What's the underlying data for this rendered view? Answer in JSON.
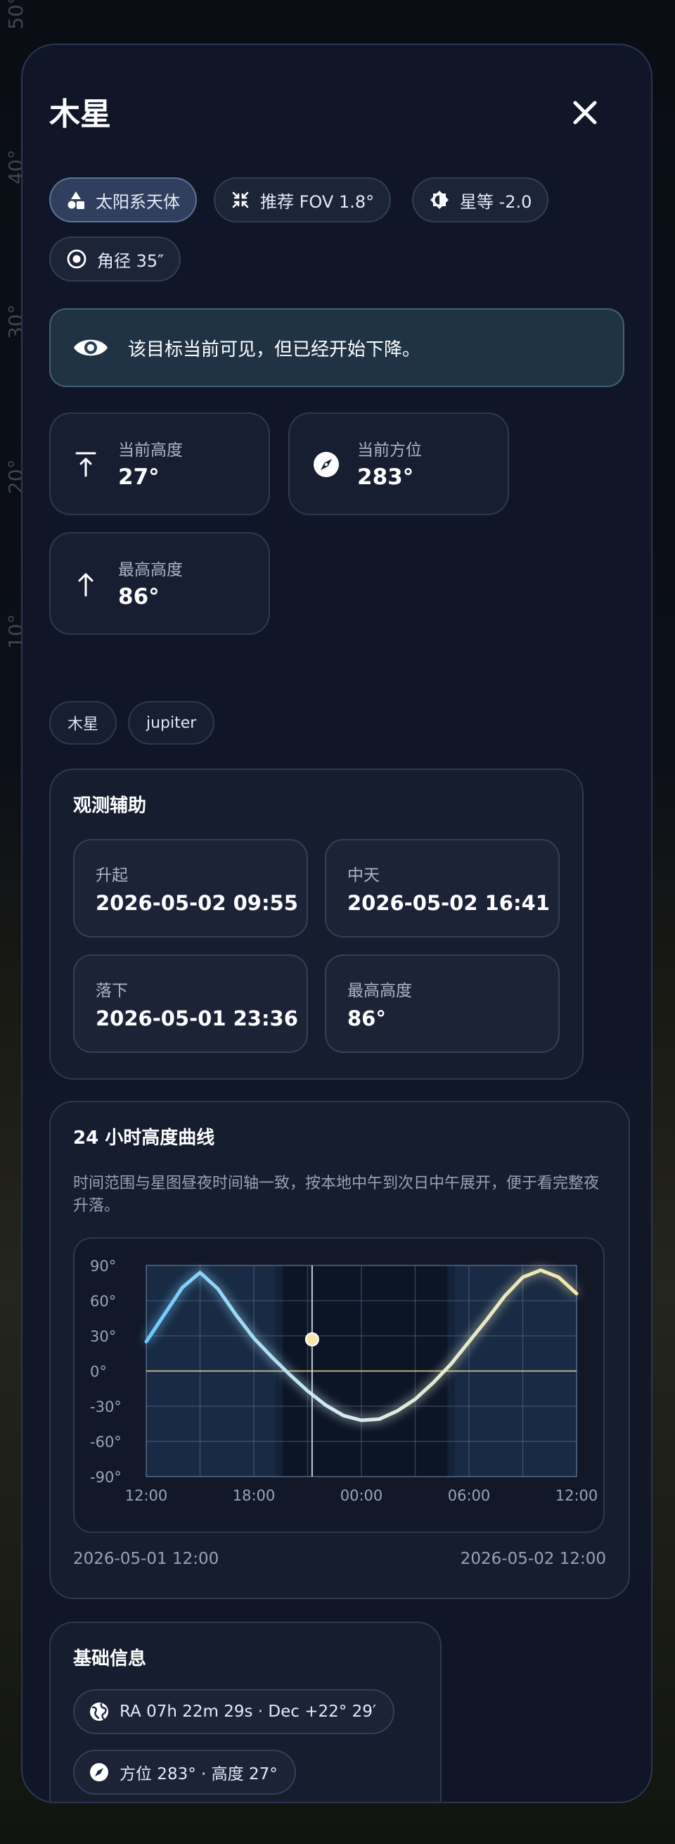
{
  "header": {
    "title": "木星"
  },
  "chips": [
    {
      "icon": "shapes-icon",
      "label": "太阳系天体"
    },
    {
      "icon": "collapse-icon",
      "label": "推荐 FOV 1.8°"
    },
    {
      "icon": "contrast-icon",
      "label": "星等 -2.0"
    },
    {
      "icon": "target-icon",
      "label": "角径 35″"
    }
  ],
  "visibility_banner": {
    "icon": "eye-icon",
    "text": "该目标当前可见，但已经开始下降。"
  },
  "stats": {
    "current_altitude": {
      "label": "当前高度",
      "value": "27°",
      "icon": "altitude-icon"
    },
    "current_azimuth": {
      "label": "当前方位",
      "value": "283°",
      "icon": "compass-icon"
    },
    "max_altitude": {
      "label": "最高高度",
      "value": "86°",
      "icon": "arrow-up-icon"
    }
  },
  "tags": [
    "木星",
    "jupiter"
  ],
  "observation": {
    "title": "观测辅助",
    "rise": {
      "label": "升起",
      "value": "2026-05-02 09:55"
    },
    "transit": {
      "label": "中天",
      "value": "2026-05-02 16:41"
    },
    "set": {
      "label": "落下",
      "value": "2026-05-01 23:36"
    },
    "max_altitude": {
      "label": "最高高度",
      "value": "86°"
    }
  },
  "altitude_curve": {
    "title": "24 小时高度曲线",
    "description": "时间范围与星图昼夜时间轴一致，按本地中午到次日中午展开，便于看完整夜升落。",
    "range_start": "2026-05-01 12:00",
    "range_end": "2026-05-02 12:00"
  },
  "chart_data": {
    "type": "line",
    "x": [
      0,
      1,
      2,
      3,
      4,
      5,
      6,
      7,
      8,
      9,
      10,
      11,
      12,
      13,
      14,
      15,
      16,
      17,
      18,
      19,
      20,
      21,
      22,
      23,
      24
    ],
    "series": [
      {
        "values": [
          25,
          48,
          71,
          84,
          70,
          48,
          28,
          12,
          -3,
          -17,
          -29,
          -38,
          -42,
          -41,
          -34,
          -24,
          -10,
          6,
          25,
          44,
          64,
          80,
          86,
          80,
          66
        ]
      }
    ],
    "xtick_labels": [
      "12:00",
      "18:00",
      "00:00",
      "06:00",
      "12:00"
    ],
    "ytick_labels": [
      "90°",
      "60°",
      "30°",
      "0°",
      "-30°",
      "-60°",
      "-90°"
    ],
    "ylim": [
      -90,
      90
    ],
    "current_time_hours": 9.25,
    "current_altitude": 27,
    "grid": true
  },
  "basic_info": {
    "title": "基础信息",
    "coords": {
      "icon": "globe-icon",
      "text": "RA 07h 22m 29s · Dec +22° 29′"
    },
    "position": {
      "icon": "compass-icon",
      "text": "方位 283° · 高度 27°"
    }
  },
  "background": {
    "ticks": [
      "50°",
      "40°",
      "30°",
      "20°",
      "10°"
    ]
  }
}
